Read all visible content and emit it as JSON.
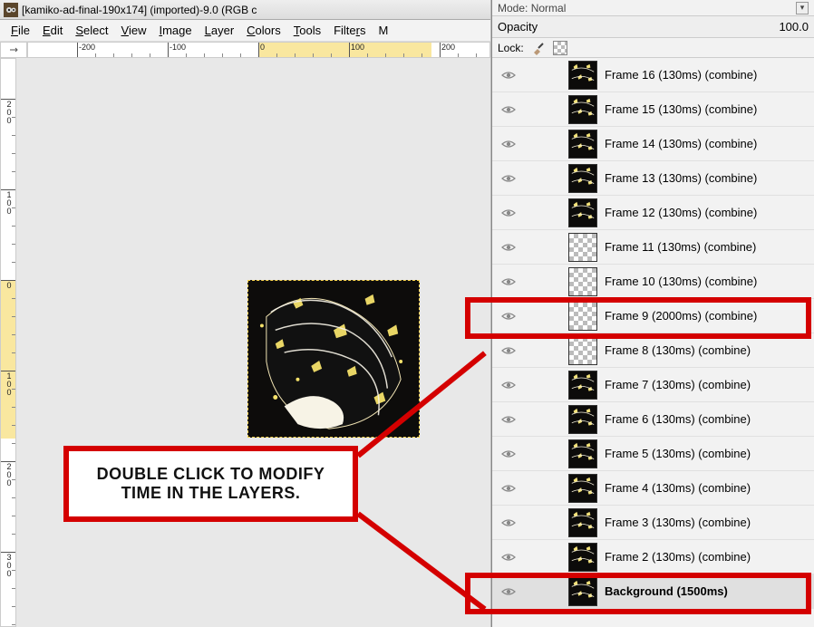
{
  "left": {
    "title": "[kamiko-ad-final-190x174] (imported)-9.0 (RGB c",
    "menu": {
      "file": "File",
      "edit": "Edit",
      "select": "Select",
      "view": "View",
      "image": "Image",
      "layer": "Layer",
      "colors": "Colors",
      "tools": "Tools",
      "filters": "Filters",
      "m": "M"
    },
    "hruler_labels": [
      "-200",
      "-100",
      "0",
      "100",
      "200"
    ],
    "vruler_labels": [
      "200",
      "100",
      "0",
      "100",
      "200",
      "300"
    ]
  },
  "annotation": {
    "text_line1": "DOUBLE CLICK TO MODIFY",
    "text_line2": "TIME IN THE LAYERS."
  },
  "right": {
    "mode_label": "Mode:",
    "mode_value": "Normal",
    "opacity_label": "Opacity",
    "opacity_value": "100.0",
    "lock_label": "Lock:",
    "layers": [
      {
        "name": "Frame 16 (130ms) (combine)",
        "thumb": "art"
      },
      {
        "name": "Frame 15 (130ms) (combine)",
        "thumb": "art"
      },
      {
        "name": "Frame 14 (130ms) (combine)",
        "thumb": "art"
      },
      {
        "name": "Frame 13 (130ms) (combine)",
        "thumb": "art"
      },
      {
        "name": "Frame 12 (130ms) (combine)",
        "thumb": "art"
      },
      {
        "name": "Frame 11 (130ms) (combine)",
        "thumb": "checker"
      },
      {
        "name": "Frame 10 (130ms) (combine)",
        "thumb": "checker"
      },
      {
        "name": "Frame 9 (2000ms) (combine)",
        "thumb": "checker",
        "highlight": true
      },
      {
        "name": "Frame 8 (130ms) (combine)",
        "thumb": "checker"
      },
      {
        "name": "Frame 7 (130ms) (combine)",
        "thumb": "art"
      },
      {
        "name": "Frame 6 (130ms) (combine)",
        "thumb": "art"
      },
      {
        "name": "Frame 5 (130ms) (combine)",
        "thumb": "art"
      },
      {
        "name": "Frame 4 (130ms) (combine)",
        "thumb": "art"
      },
      {
        "name": "Frame 3 (130ms) (combine)",
        "thumb": "art"
      },
      {
        "name": "Frame 2 (130ms) (combine)",
        "thumb": "art"
      },
      {
        "name": "Background (1500ms)",
        "thumb": "art",
        "bold": true,
        "highlight": true
      }
    ]
  }
}
